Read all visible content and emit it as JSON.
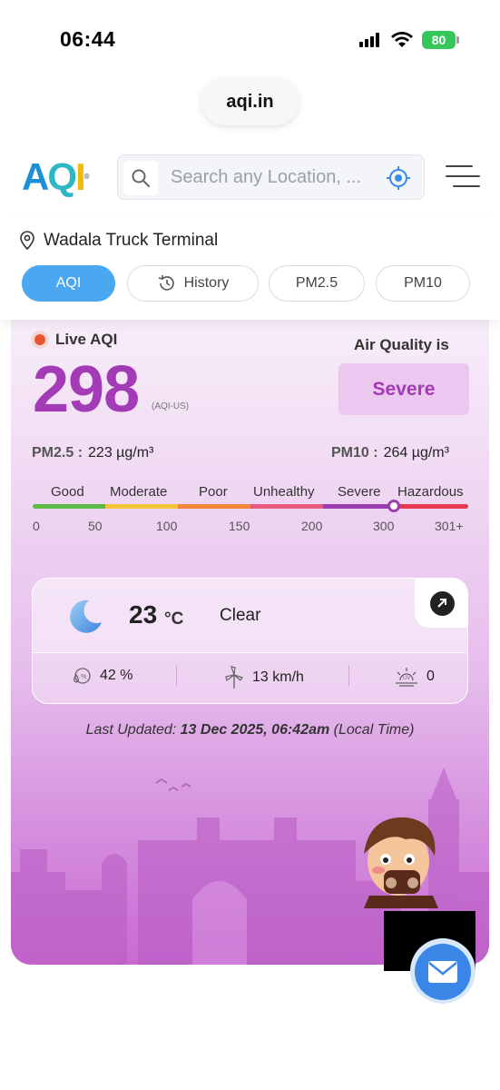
{
  "status_bar": {
    "time": "06:44",
    "battery": "80"
  },
  "browser": {
    "url": "aqi.in"
  },
  "header": {
    "logo": {
      "a": "A",
      "q": "Q",
      "i": "I",
      "reg": "®"
    },
    "search_placeholder": "Search any Location, ..."
  },
  "location": {
    "name": "Wadala Truck Terminal"
  },
  "tabs": [
    {
      "label": "AQI",
      "active": true
    },
    {
      "label": "History",
      "active": false
    },
    {
      "label": "PM2.5",
      "active": false
    },
    {
      "label": "PM10",
      "active": false
    }
  ],
  "aqi": {
    "live_label": "Live AQI",
    "value": "298",
    "unit": "(AQI-US)",
    "quality_label": "Air Quality is",
    "status": "Severe",
    "status_color": "#a23bb5",
    "pm25_label": "PM2.5 :",
    "pm25_value": "223 µg/m³",
    "pm10_label": "PM10 :",
    "pm10_value": "264 µg/m³"
  },
  "scale": {
    "categories": [
      "Good",
      "Moderate",
      "Poor",
      "Unhealthy",
      "Severe",
      "Hazardous"
    ],
    "ticks": [
      "0",
      "50",
      "100",
      "150",
      "200",
      "300",
      "301+"
    ],
    "colors": [
      "#5bbb46",
      "#f3c33a",
      "#f2863a",
      "#e85b7c",
      "#9b3db0",
      "#e53950"
    ],
    "pointer_value": 298
  },
  "weather": {
    "icon": "moon-icon",
    "temp": "23",
    "temp_unit": "°C",
    "condition": "Clear",
    "humidity": "42 %",
    "wind": "13 km/h",
    "uv": "0"
  },
  "last_updated": {
    "prefix": "Last Updated:",
    "value": "13 Dec 2025, 06:42am",
    "suffix": "(Local Time)"
  }
}
